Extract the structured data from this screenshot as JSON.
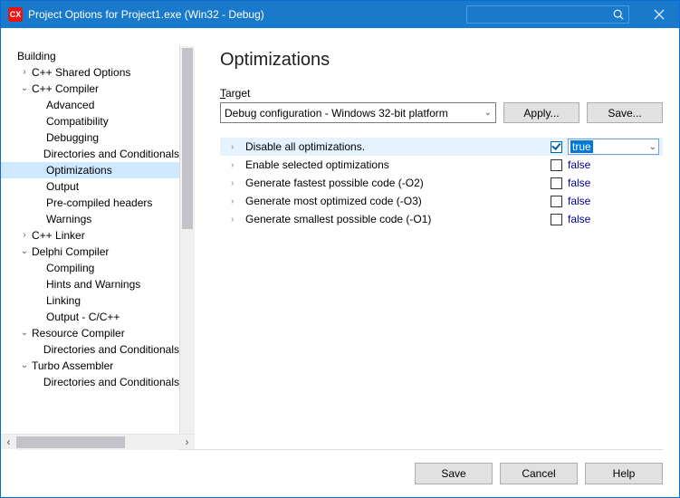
{
  "titlebar": {
    "app_icon_text": "CX",
    "title": "Project Options for Project1.exe  (Win32 - Debug)"
  },
  "tree": {
    "items": [
      {
        "label": "Building",
        "indent": 0,
        "twisty": "",
        "selected": false
      },
      {
        "label": "C++ Shared Options",
        "indent": 1,
        "twisty": "›",
        "selected": false
      },
      {
        "label": "C++ Compiler",
        "indent": 1,
        "twisty": "⌄",
        "selected": false
      },
      {
        "label": "Advanced",
        "indent": 2,
        "twisty": "",
        "selected": false
      },
      {
        "label": "Compatibility",
        "indent": 2,
        "twisty": "",
        "selected": false
      },
      {
        "label": "Debugging",
        "indent": 2,
        "twisty": "",
        "selected": false
      },
      {
        "label": "Directories and Conditionals",
        "indent": 2,
        "twisty": "",
        "selected": false
      },
      {
        "label": "Optimizations",
        "indent": 2,
        "twisty": "",
        "selected": true
      },
      {
        "label": "Output",
        "indent": 2,
        "twisty": "",
        "selected": false
      },
      {
        "label": "Pre-compiled headers",
        "indent": 2,
        "twisty": "",
        "selected": false
      },
      {
        "label": "Warnings",
        "indent": 2,
        "twisty": "",
        "selected": false
      },
      {
        "label": "C++ Linker",
        "indent": 1,
        "twisty": "›",
        "selected": false
      },
      {
        "label": "Delphi Compiler",
        "indent": 1,
        "twisty": "⌄",
        "selected": false
      },
      {
        "label": "Compiling",
        "indent": 2,
        "twisty": "",
        "selected": false
      },
      {
        "label": "Hints and Warnings",
        "indent": 2,
        "twisty": "",
        "selected": false
      },
      {
        "label": "Linking",
        "indent": 2,
        "twisty": "",
        "selected": false
      },
      {
        "label": "Output - C/C++",
        "indent": 2,
        "twisty": "",
        "selected": false
      },
      {
        "label": "Resource Compiler",
        "indent": 1,
        "twisty": "⌄",
        "selected": false
      },
      {
        "label": "Directories and Conditionals",
        "indent": 2,
        "twisty": "",
        "selected": false
      },
      {
        "label": "Turbo Assembler",
        "indent": 1,
        "twisty": "⌄",
        "selected": false
      },
      {
        "label": "Directories and Conditionals",
        "indent": 2,
        "twisty": "",
        "selected": false
      }
    ]
  },
  "page": {
    "title": "Optimizations",
    "target_label_pre": "T",
    "target_label_rest": "arget",
    "target_value": "Debug configuration - Windows 32-bit platform",
    "apply_label": "Apply...",
    "save_label": "Save..."
  },
  "options": [
    {
      "label": "Disable all optimizations.",
      "value": "true",
      "checked": true,
      "selected": true
    },
    {
      "label": "Enable selected optimizations",
      "value": "false",
      "checked": false,
      "selected": false
    },
    {
      "label": "Generate fastest possible code (-O2)",
      "value": "false",
      "checked": false,
      "selected": false
    },
    {
      "label": "Generate most optimized code (-O3)",
      "value": "false",
      "checked": false,
      "selected": false
    },
    {
      "label": "Generate smallest possible code (-O1)",
      "value": "false",
      "checked": false,
      "selected": false
    }
  ],
  "footer": {
    "save": "Save",
    "cancel": "Cancel",
    "help": "Help"
  }
}
